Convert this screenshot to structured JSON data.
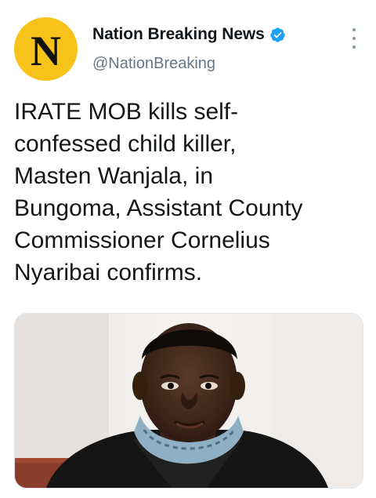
{
  "account": {
    "avatar_letter": "N",
    "avatar_color": "#f7c21a",
    "display_name": "Nation Breaking News",
    "handle": "@NationBreaking",
    "verified": true,
    "verified_color": "#1da1f2"
  },
  "tweet": {
    "text": "IRATE MOB kills self-\nconfessed child killer,\nMasten Wanjala, in\nBungoma, Assistant County\nCommissioner Cornelius\nNyaribai confirms."
  },
  "icons": {
    "more": "more-vertical-icon",
    "verified": "verified-badge-icon"
  },
  "media": {
    "type": "photo"
  }
}
